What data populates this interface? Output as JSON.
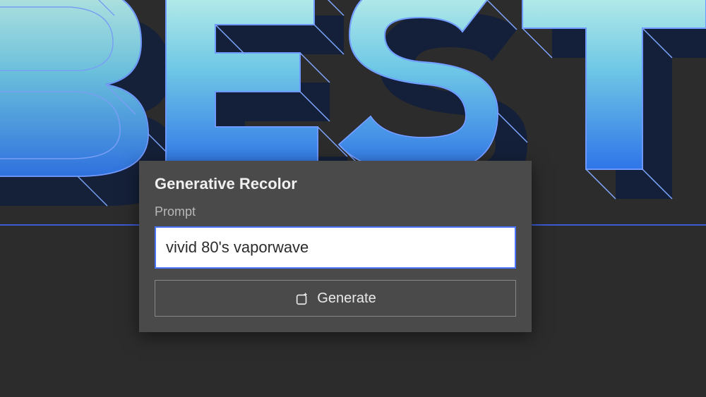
{
  "background": {
    "artwork_text": "BEST",
    "colors": {
      "wire_primary": "#3b6fff",
      "wire_light": "#7ea6ff",
      "face_gradient_top": "#bff0e8",
      "face_gradient_bottom": "#2f75e8",
      "canvas": "#2c2c2c"
    }
  },
  "panel": {
    "title": "Generative Recolor",
    "prompt_label": "Prompt",
    "prompt_value": "vivid 80's vaporwave",
    "generate_label": "Generate"
  }
}
